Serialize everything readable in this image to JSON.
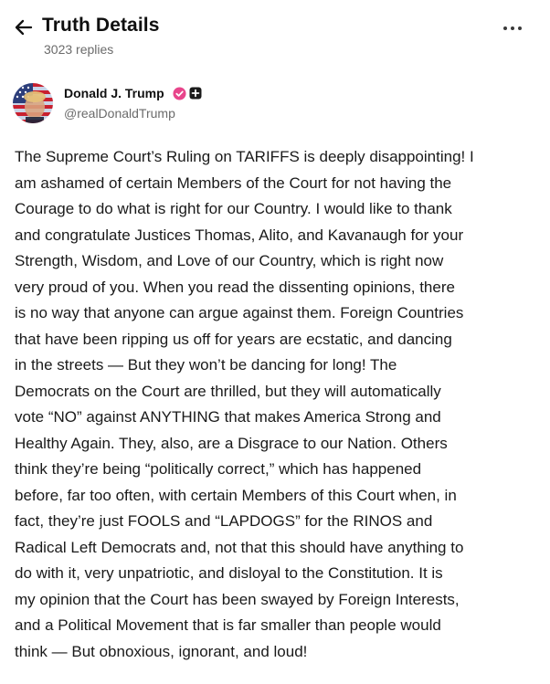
{
  "header": {
    "title": "Truth Details",
    "replies": "3023 replies",
    "back_icon": "arrow-left-icon",
    "more_icon": "more-horizontal-icon"
  },
  "author": {
    "name": "Donald J. Trump",
    "handle": "@realDonaldTrump",
    "verified_icon": "verified-badge-icon",
    "badge_icon": "plus-badge-icon",
    "verified_color": "#e8458b"
  },
  "post": {
    "lines": [
      "The Supreme Court’s Ruling on TARIFFS is deeply disappointing! I",
      "am ashamed of certain Members of the Court for not having the",
      "Courage to do what is right for our Country. I would like to thank",
      "and congratulate Justices Thomas, Alito, and Kavanaugh for your",
      "Strength, Wisdom, and Love of our Country, which is right now",
      "very proud of you. When you read the dissenting opinions, there",
      "is no way that anyone can argue against them. Foreign Countries",
      "that have been ripping us off for years are ecstatic, and dancing",
      "in the streets — But they won’t be dancing for long! The",
      "Democrats on the Court are thrilled, but they will automatically",
      "vote “NO” against ANYTHING that makes America Strong and",
      "Healthy Again. They, also, are a Disgrace to our Nation. Others",
      "think they’re being “politically correct,” which has happened",
      "before, far too often, with certain Members of this Court when, in",
      "fact, they’re just FOOLS and “LAPDOGS” for the RINOS and",
      "Radical Left Democrats and, not that this should have anything to",
      "do with it, very unpatriotic, and disloyal to the Constitution. It is",
      "my opinion that the Court has been swayed by Foreign Interests,",
      "and a Political Movement that is far smaller than people would",
      "think — But obnoxious, ignorant, and loud!"
    ]
  }
}
